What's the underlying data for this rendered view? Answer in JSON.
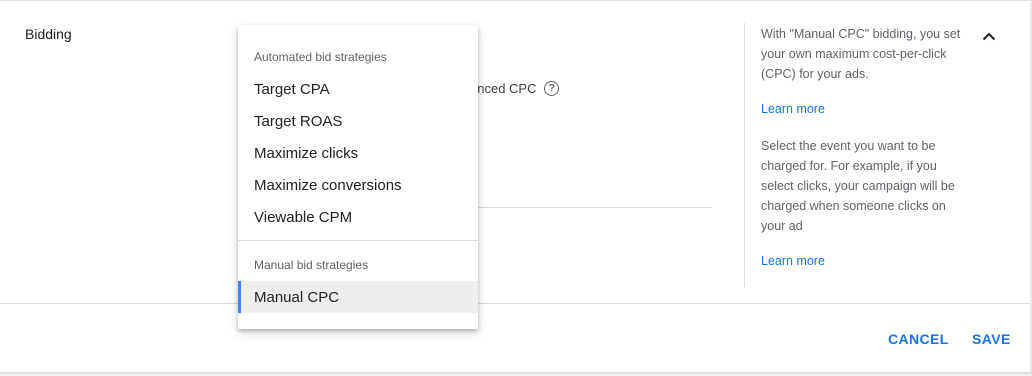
{
  "section": {
    "title": "Bidding"
  },
  "content": {
    "enhanced_cpc_fragment": "anced CPC",
    "help_icon_glyph": "?"
  },
  "help_panel": {
    "paragraph1": "With \"Manual CPC\" bidding, you set your own maximum cost-per-click (CPC) for your ads.",
    "link1": "Learn more",
    "paragraph2": "Select the event you want to be charged for. For example, if you select clicks, your campaign will be charged when someone clicks on your ad",
    "link2": "Learn more"
  },
  "dropdown": {
    "groups": [
      {
        "label": "Automated bid strategies",
        "items": [
          "Target CPA",
          "Target ROAS",
          "Maximize clicks",
          "Maximize conversions",
          "Viewable CPM"
        ]
      },
      {
        "label": "Manual bid strategies",
        "items": [
          "Manual CPC"
        ]
      }
    ],
    "selected": "Manual CPC"
  },
  "footer": {
    "cancel_label": "CANCEL",
    "save_label": "SAVE"
  },
  "icons": {
    "collapse": "chevron-up-icon",
    "help": "help-circle-icon"
  },
  "colors": {
    "accent": "#1a73e8",
    "selected_bar": "#4285f4",
    "selected_bg": "#eeeeee"
  }
}
